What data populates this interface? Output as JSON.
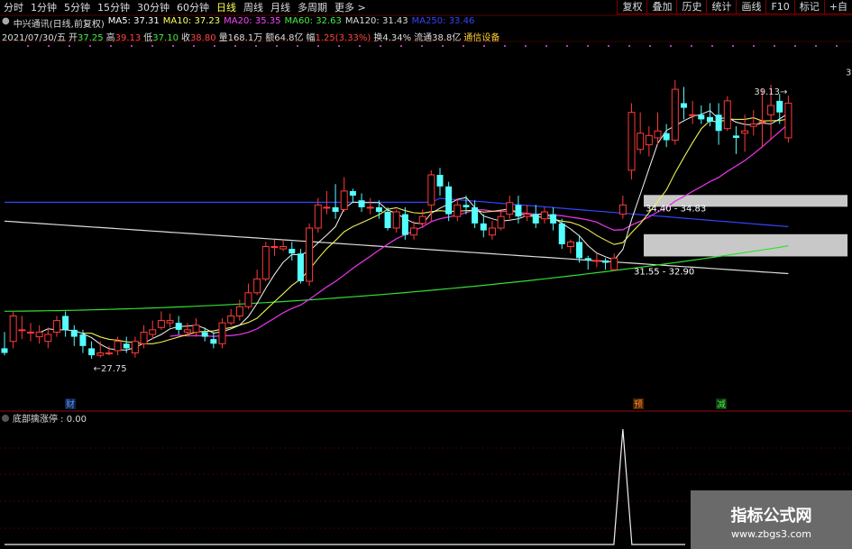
{
  "timeframes": [
    {
      "label": "分时",
      "active": false
    },
    {
      "label": "1分钟",
      "active": false
    },
    {
      "label": "5分钟",
      "active": false
    },
    {
      "label": "15分钟",
      "active": false
    },
    {
      "label": "30分钟",
      "active": false
    },
    {
      "label": "60分钟",
      "active": false
    },
    {
      "label": "日线",
      "active": true
    },
    {
      "label": "周线",
      "active": false
    },
    {
      "label": "月线",
      "active": false
    },
    {
      "label": "多周期",
      "active": false
    },
    {
      "label": "更多 >",
      "active": false
    }
  ],
  "toolbar": [
    "复权",
    "叠加",
    "历史",
    "统计",
    "画线",
    "F10",
    "标记",
    "+自"
  ],
  "stock": {
    "name": "中兴通讯(日线,前复权)",
    "ma": [
      {
        "label": "MA5: 37.31",
        "color": "#ffffff"
      },
      {
        "label": "MA10: 37.23",
        "color": "#ffff66"
      },
      {
        "label": "MA20: 35.35",
        "color": "#ff44ff"
      },
      {
        "label": "MA60: 32.63",
        "color": "#44ee44"
      },
      {
        "label": "MA120: 31.43",
        "color": "#dddddd"
      },
      {
        "label": "MA250: 33.46",
        "color": "#3344ff"
      }
    ]
  },
  "quote": {
    "date": "2021/07/30/五",
    "items": [
      {
        "label": "开",
        "value": "37.25",
        "vcolor": "#44ee44"
      },
      {
        "label": "高",
        "value": "39.13",
        "vcolor": "#ff4444"
      },
      {
        "label": "低",
        "value": "37.10",
        "vcolor": "#44ee44"
      },
      {
        "label": "收",
        "value": "38.80",
        "vcolor": "#ff4444"
      },
      {
        "label": "量",
        "value": "168.1万",
        "vcolor": "#dddddd"
      },
      {
        "label": "额",
        "value": "64.8亿",
        "vcolor": "#dddddd"
      },
      {
        "label": "幅",
        "value": "1.25(3.33%)",
        "vcolor": "#ff4444"
      },
      {
        "label": "换",
        "value": "4.34%",
        "vcolor": "#dddddd"
      },
      {
        "label": "流通",
        "value": "38.8亿",
        "vcolor": "#dddddd"
      }
    ],
    "sector": "通信设备"
  },
  "annotations": {
    "high": "39.13",
    "low": "27.75",
    "zone_upper": "34.40 - 34.83",
    "zone_lower": "31.55 - 32.90",
    "edge_label": "3"
  },
  "markers": [
    {
      "label": "财",
      "color": "#5599ff",
      "bg": "#112244"
    },
    {
      "label": "预",
      "color": "#ff8833",
      "bg": "#442200"
    },
    {
      "label": "减",
      "color": "#44ee44",
      "bg": "#113311"
    }
  ],
  "indicator": {
    "label": "底部擒涨停 : 0.00"
  },
  "watermark": {
    "title": "指标公式网",
    "url": "www.zbgs3.com"
  },
  "chart_data": {
    "type": "candlestick",
    "ylim": [
      26.5,
      41
    ],
    "candles": [
      [
        28.2,
        28.0,
        28.9,
        27.9
      ],
      [
        28.5,
        29.6,
        29.8,
        28.2
      ],
      [
        29.0,
        29.0,
        29.6,
        28.6
      ],
      [
        28.9,
        28.9,
        29.3,
        28.5
      ],
      [
        28.7,
        28.9,
        29.2,
        28.4
      ],
      [
        28.5,
        28.8,
        29.1,
        28.2
      ],
      [
        28.9,
        29.4,
        29.6,
        28.7
      ],
      [
        29.6,
        29.0,
        29.8,
        28.7
      ],
      [
        29.0,
        28.7,
        29.2,
        28.3
      ],
      [
        28.8,
        28.3,
        29.0,
        28.0
      ],
      [
        28.2,
        27.9,
        28.5,
        27.75
      ],
      [
        27.9,
        28.0,
        28.5,
        27.8
      ],
      [
        28.0,
        28.0,
        28.3,
        27.9
      ],
      [
        28.1,
        28.5,
        28.7,
        27.9
      ],
      [
        28.4,
        28.2,
        28.7,
        28.0
      ],
      [
        28.0,
        28.5,
        28.7,
        27.8
      ],
      [
        28.4,
        28.9,
        29.2,
        28.2
      ],
      [
        28.8,
        29.0,
        29.4,
        28.6
      ],
      [
        29.1,
        29.4,
        29.8,
        29.0
      ],
      [
        29.3,
        29.4,
        29.7,
        29.1
      ],
      [
        29.3,
        29.0,
        29.6,
        28.8
      ],
      [
        28.9,
        29.0,
        29.3,
        28.7
      ],
      [
        28.9,
        29.2,
        29.5,
        28.7
      ],
      [
        28.9,
        28.7,
        29.1,
        28.5
      ],
      [
        28.6,
        28.4,
        28.9,
        28.2
      ],
      [
        28.4,
        29.3,
        29.5,
        28.2
      ],
      [
        29.3,
        29.6,
        29.9,
        29.2
      ],
      [
        29.6,
        30.0,
        30.3,
        29.4
      ],
      [
        30.0,
        30.6,
        31.0,
        29.9
      ],
      [
        30.6,
        31.2,
        31.6,
        30.5
      ],
      [
        31.2,
        32.6,
        32.8,
        31.1
      ],
      [
        32.6,
        32.6,
        32.9,
        32.2
      ],
      [
        32.5,
        32.6,
        32.9,
        32.4
      ],
      [
        32.5,
        32.3,
        32.8,
        32.0
      ],
      [
        32.3,
        31.1,
        32.5,
        31.0
      ],
      [
        31.1,
        33.4,
        33.6,
        30.9
      ],
      [
        33.4,
        34.4,
        34.7,
        33.2
      ],
      [
        34.3,
        34.3,
        35.0,
        34.0
      ],
      [
        34.3,
        34.1,
        35.3,
        33.8
      ],
      [
        34.2,
        35.0,
        35.6,
        34.1
      ],
      [
        35.0,
        34.8,
        35.1,
        34.5
      ],
      [
        34.6,
        34.3,
        34.9,
        34.1
      ],
      [
        34.3,
        34.3,
        34.7,
        34.0
      ],
      [
        34.3,
        34.1,
        34.6,
        33.8
      ],
      [
        34.1,
        33.4,
        34.3,
        33.3
      ],
      [
        33.4,
        34.1,
        34.2,
        33.2
      ],
      [
        34.0,
        33.1,
        34.3,
        32.9
      ],
      [
        33.1,
        33.4,
        33.7,
        32.9
      ],
      [
        33.6,
        33.9,
        34.2,
        33.4
      ],
      [
        34.4,
        35.7,
        35.9,
        33.7
      ],
      [
        35.7,
        35.2,
        36.0,
        34.8
      ],
      [
        35.2,
        34.0,
        35.4,
        33.7
      ],
      [
        33.9,
        34.4,
        34.7,
        33.7
      ],
      [
        34.4,
        34.3,
        34.8,
        34.0
      ],
      [
        34.3,
        33.6,
        34.6,
        33.4
      ],
      [
        33.6,
        33.3,
        34.0,
        33.0
      ],
      [
        33.1,
        33.4,
        33.7,
        32.9
      ],
      [
        33.4,
        33.9,
        34.1,
        33.3
      ],
      [
        34.0,
        34.5,
        34.8,
        33.8
      ],
      [
        34.4,
        33.9,
        34.8,
        33.6
      ],
      [
        33.9,
        34.0,
        34.4,
        33.7
      ],
      [
        34.0,
        33.6,
        34.4,
        33.4
      ],
      [
        33.8,
        34.1,
        34.3,
        33.6
      ],
      [
        34.0,
        33.6,
        34.3,
        33.3
      ],
      [
        33.6,
        32.7,
        33.8,
        32.5
      ],
      [
        32.6,
        32.8,
        32.9,
        32.3
      ],
      [
        32.8,
        32.1,
        33.1,
        31.9
      ],
      [
        32.1,
        32.0,
        32.2,
        31.6
      ],
      [
        32.0,
        32.0,
        32.3,
        31.7
      ],
      [
        32.0,
        31.9,
        32.1,
        31.6
      ],
      [
        31.6,
        32.1,
        32.3,
        31.55
      ],
      [
        34.0,
        34.4,
        34.8,
        33.8
      ],
      [
        35.9,
        38.4,
        38.8,
        35.5
      ],
      [
        36.8,
        37.5,
        38.4,
        36.6
      ],
      [
        37.0,
        37.4,
        37.8,
        36.5
      ],
      [
        37.3,
        37.6,
        38.4,
        37.0
      ],
      [
        37.5,
        37.2,
        37.9,
        36.9
      ],
      [
        37.2,
        39.4,
        39.8,
        37.0
      ],
      [
        38.8,
        38.6,
        39.5,
        38.1
      ],
      [
        38.3,
        38.3,
        38.9,
        37.9
      ],
      [
        38.3,
        38.1,
        38.7,
        37.9
      ],
      [
        38.2,
        38.0,
        38.8,
        37.8
      ],
      [
        38.3,
        37.6,
        38.8,
        37.0
      ],
      [
        37.7,
        38.9,
        39.1,
        37.6
      ],
      [
        37.4,
        37.3,
        37.8,
        36.6
      ],
      [
        37.5,
        37.6,
        38.3,
        36.7
      ],
      [
        37.8,
        37.9,
        38.5,
        37.4
      ],
      [
        38.0,
        38.0,
        39.4,
        36.9
      ],
      [
        38.3,
        38.7,
        39.6,
        37.2
      ],
      [
        38.9,
        38.4,
        39.2,
        37.9
      ],
      [
        37.3,
        38.8,
        39.13,
        37.1
      ]
    ],
    "ma_series": [
      {
        "name": "MA120",
        "start": 31.5,
        "end": 31.43
      },
      {
        "name": "MA250",
        "start": 34.7,
        "end": 33.46
      },
      {
        "name": "MA60",
        "start": 29.8,
        "end": 32.63
      }
    ],
    "indicator_series": {
      "name": "底部擒涨停",
      "spike_index": 71
    }
  }
}
